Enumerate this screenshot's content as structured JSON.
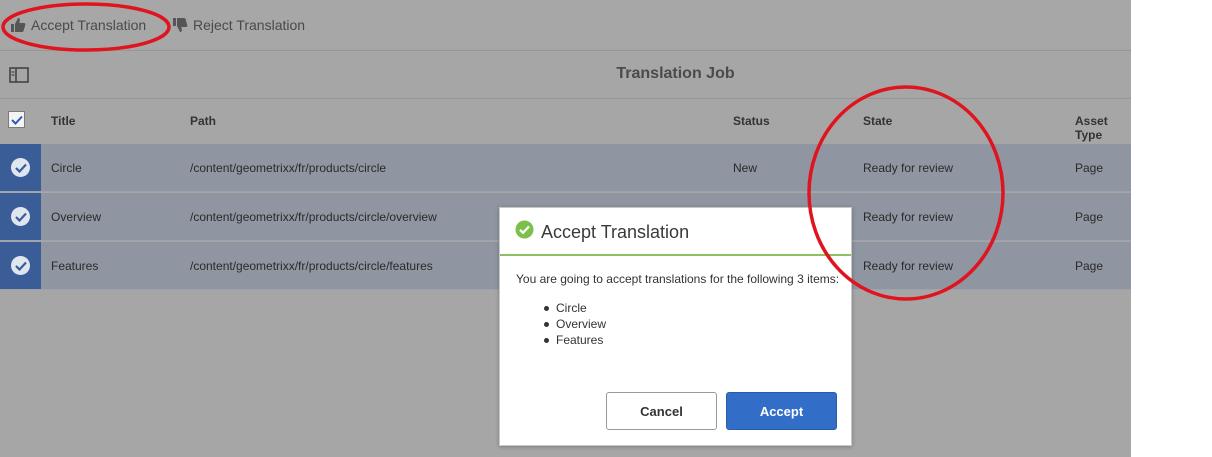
{
  "toolbar": {
    "accept_label": "Accept Translation",
    "reject_label": "Reject Translation"
  },
  "header": {
    "title": "Translation Job"
  },
  "table": {
    "columns": [
      "Title",
      "Path",
      "Status",
      "State",
      "Asset Type"
    ],
    "rows": [
      {
        "title": "Circle",
        "path": "/content/geometrixx/fr/products/circle",
        "status": "New",
        "state": "Ready for review",
        "asset_type": "Page"
      },
      {
        "title": "Overview",
        "path": "/content/geometrixx/fr/products/circle/overview",
        "status": "",
        "state": "Ready for review",
        "asset_type": "Page"
      },
      {
        "title": "Features",
        "path": "/content/geometrixx/fr/products/circle/features",
        "status": "",
        "state": "Ready for review",
        "asset_type": "Page"
      }
    ]
  },
  "dialog": {
    "title": "Accept Translation",
    "message": "You are going to accept translations for the following 3 items:",
    "items": [
      "Circle",
      "Overview",
      "Features"
    ],
    "cancel_label": "Cancel",
    "accept_label": "Accept"
  },
  "colors": {
    "selection": "#3b5d97",
    "accent_button": "#326ec8",
    "success": "#7cc04b",
    "annotation": "#e0141e"
  },
  "icons": {
    "accept": "thumbs-up-icon",
    "reject": "thumbs-down-icon",
    "rail": "rail-toggle-icon",
    "check": "check-icon",
    "success": "success-check-icon"
  }
}
